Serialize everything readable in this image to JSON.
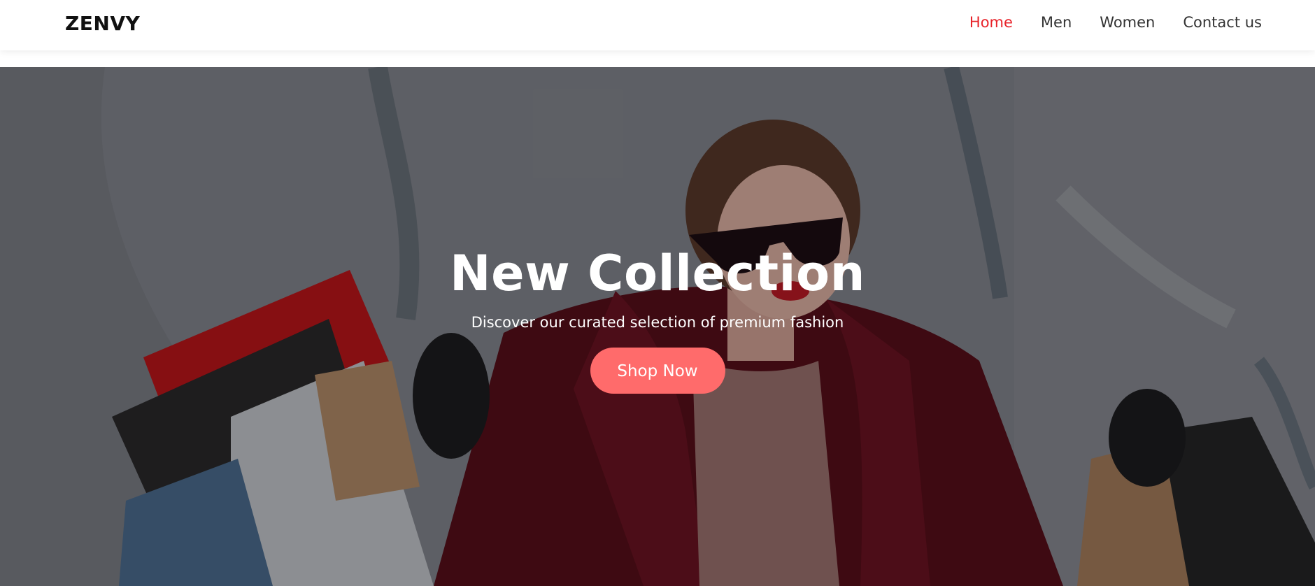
{
  "brand": {
    "logo_text": "ZENVY"
  },
  "nav": {
    "items": [
      {
        "label": "Home",
        "active": true
      },
      {
        "label": "Men",
        "active": false
      },
      {
        "label": "Women",
        "active": false
      },
      {
        "label": "Contact us",
        "active": false
      }
    ]
  },
  "hero": {
    "title": "New Collection",
    "subtitle": "Discover our curated selection of premium fashion",
    "cta_label": "Shop Now"
  },
  "colors": {
    "accent": "#e8232a",
    "cta_background": "#ff6b6b",
    "header_background": "#ffffff",
    "text_dark": "#333333"
  },
  "icons": {
    "hero_image": "woman-with-shopping-bags-photo"
  }
}
